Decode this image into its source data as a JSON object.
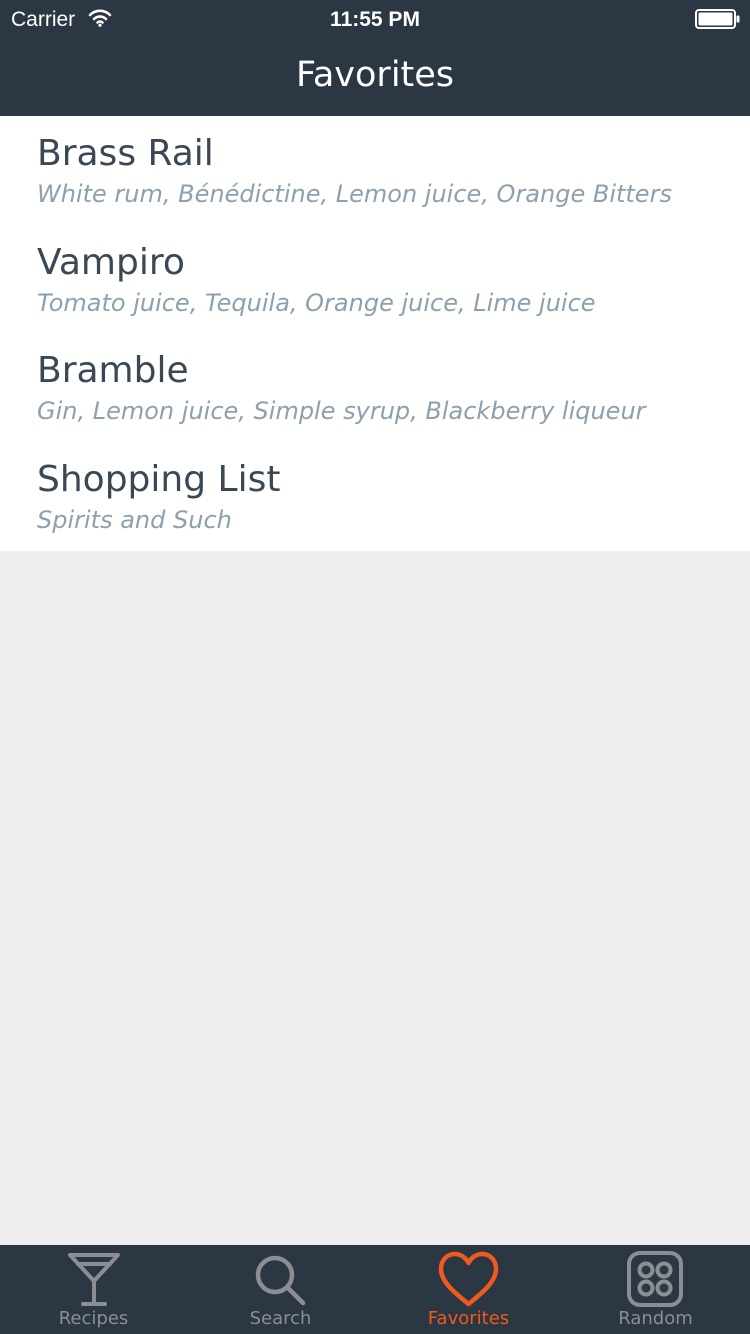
{
  "status_bar": {
    "carrier": "Carrier",
    "time": "11:55 PM",
    "wifi_icon": "wifi-icon",
    "battery_icon": "battery-icon"
  },
  "nav": {
    "title": "Favorites"
  },
  "favorites": [
    {
      "title": "Brass Rail",
      "subtitle": "White rum, Bénédictine, Lemon juice, Orange Bitters"
    },
    {
      "title": "Vampiro",
      "subtitle": "Tomato juice, Tequila, Orange juice, Lime juice"
    },
    {
      "title": "Bramble",
      "subtitle": "Gin, Lemon juice, Simple syrup, Blackberry liqueur"
    },
    {
      "title": "Shopping List",
      "subtitle": "Spirits and Such"
    }
  ],
  "tabs": [
    {
      "label": "Recipes",
      "icon": "cocktail-glass-icon",
      "active": false
    },
    {
      "label": "Search",
      "icon": "search-icon",
      "active": false
    },
    {
      "label": "Favorites",
      "icon": "heart-icon",
      "active": true
    },
    {
      "label": "Random",
      "icon": "dice-icon",
      "active": false
    }
  ],
  "colors": {
    "bar_background": "#2b3742",
    "accent": "#f05a1e",
    "inactive_tab": "#8b8e92",
    "title_text": "#3a4855",
    "subtitle_text": "#8ca0ad",
    "empty_background": "#eeeeee"
  }
}
